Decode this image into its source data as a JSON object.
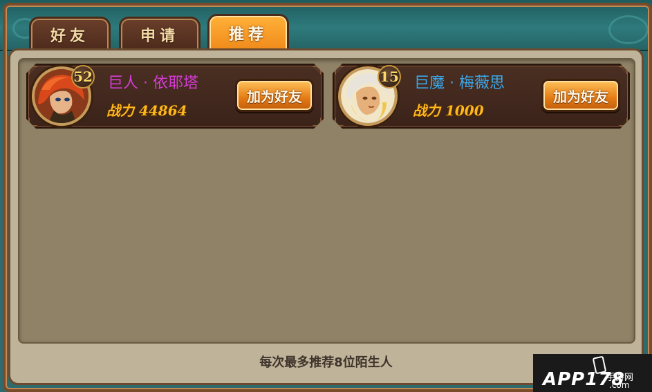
{
  "tabs": [
    {
      "label": "好友",
      "active": false
    },
    {
      "label": "申请",
      "active": false
    },
    {
      "label": "推荐",
      "active": true
    }
  ],
  "recommendations": [
    {
      "level": "52",
      "name": "巨人 · 依耶塔",
      "name_color": "#d63cd6",
      "power_label": "战力",
      "power_value": "44864",
      "add_button": "加为好友",
      "avatar_icon": "red-haired-hero-portrait"
    },
    {
      "level": "15",
      "name": "巨魔 · 梅薇思",
      "name_color": "#3aa7e8",
      "power_label": "战力",
      "power_value": "1000",
      "add_button": "加为好友",
      "avatar_icon": "white-haired-hero-portrait"
    }
  ],
  "footer_text": "每次最多推荐8位陌生人",
  "watermark": {
    "main": "APP178",
    "sub1": "手游网",
    "sub2": ".com"
  },
  "colors": {
    "tab_active": "#f08a1a",
    "power_text": "#ffb81c",
    "panel_bg": "#bfb39a"
  }
}
